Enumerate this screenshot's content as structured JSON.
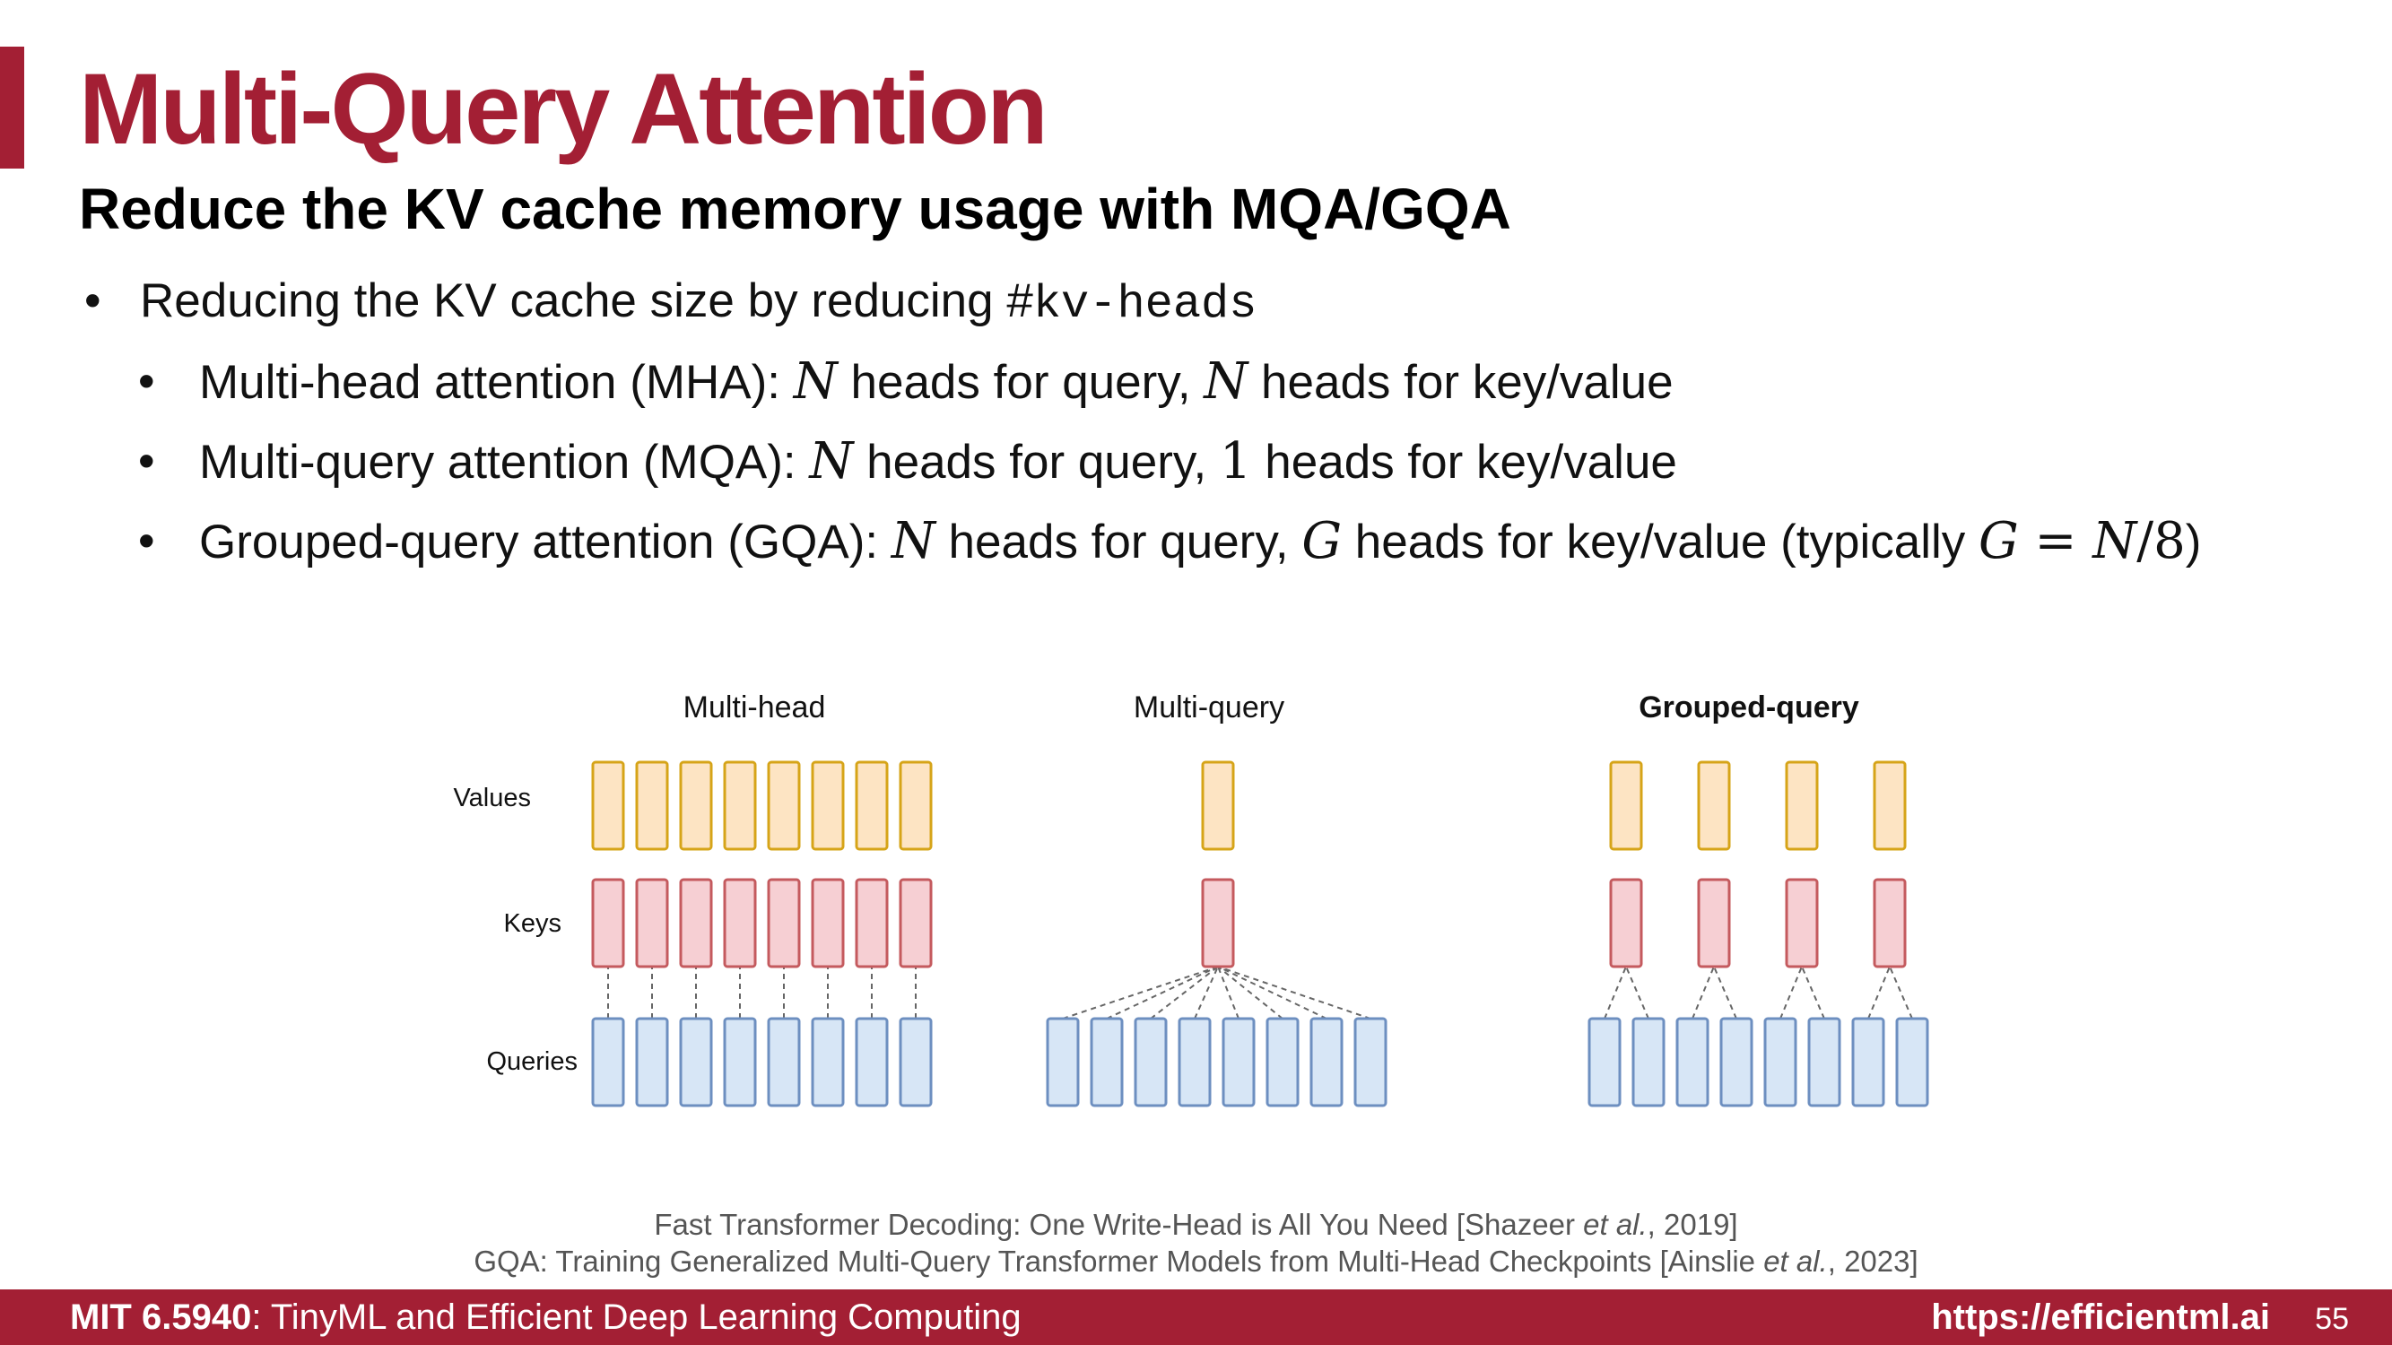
{
  "title": "Multi-Query Attention",
  "subtitle": "Reduce the KV cache memory usage with MQA/GQA",
  "bullets": {
    "b1": {
      "text": "Reducing the KV cache size by reducing #",
      "code": "kv-heads"
    },
    "b2": {
      "prefix": "Multi-head attention (MHA): ",
      "n1": "N",
      "mid": " heads for query, ",
      "n2": "N",
      "suffix": " heads for key/value"
    },
    "b3": {
      "prefix": "Multi-query attention (MQA): ",
      "n1": "N",
      "mid": " heads for query, ",
      "n2": "1",
      "suffix": " heads for key/value"
    },
    "b4": {
      "prefix": "Grouped-query attention (GQA): ",
      "n1": "N",
      "mid": " heads for query, ",
      "n2": "G",
      "mid2": " heads for key/value (typically ",
      "g": "G",
      "eq": " = ",
      "n3": "N",
      "frac": "/8",
      "suffix": ")"
    }
  },
  "diagram": {
    "row_labels": {
      "values": "Values",
      "keys": "Keys",
      "queries": "Queries"
    },
    "panels": {
      "mha": {
        "label": "Multi-head",
        "query_heads": 8,
        "kv_heads": 8
      },
      "mqa": {
        "label": "Multi-query",
        "query_heads": 8,
        "kv_heads": 1
      },
      "gqa": {
        "label": "Grouped-query",
        "query_heads": 8,
        "kv_heads": 4
      }
    },
    "colors": {
      "values_fill": "#fde4c3",
      "values_stroke": "#d6a418",
      "keys_fill": "#f6cfd3",
      "keys_stroke": "#c45a5e",
      "queries_fill": "#d7e6f6",
      "queries_stroke": "#6d8fc0",
      "connector": "#666666"
    }
  },
  "references": {
    "ref1": {
      "a": "Fast Transformer Decoding: One Write-Head is All You Need [Shazeer ",
      "etal": "et al.",
      "b": ", 2019]"
    },
    "ref2": {
      "a": "GQA: Training Generalized Multi-Query Transformer Models from Multi-Head Checkpoints [Ainslie ",
      "etal": "et al.",
      "b": ", 2023]"
    }
  },
  "footer": {
    "course_code": "MIT 6.5940",
    "course_name": ": TinyML and Efficient Deep Learning Computing",
    "url": "https://efficientml.ai",
    "page": "55"
  },
  "theme": {
    "accent": "#a31f34"
  }
}
